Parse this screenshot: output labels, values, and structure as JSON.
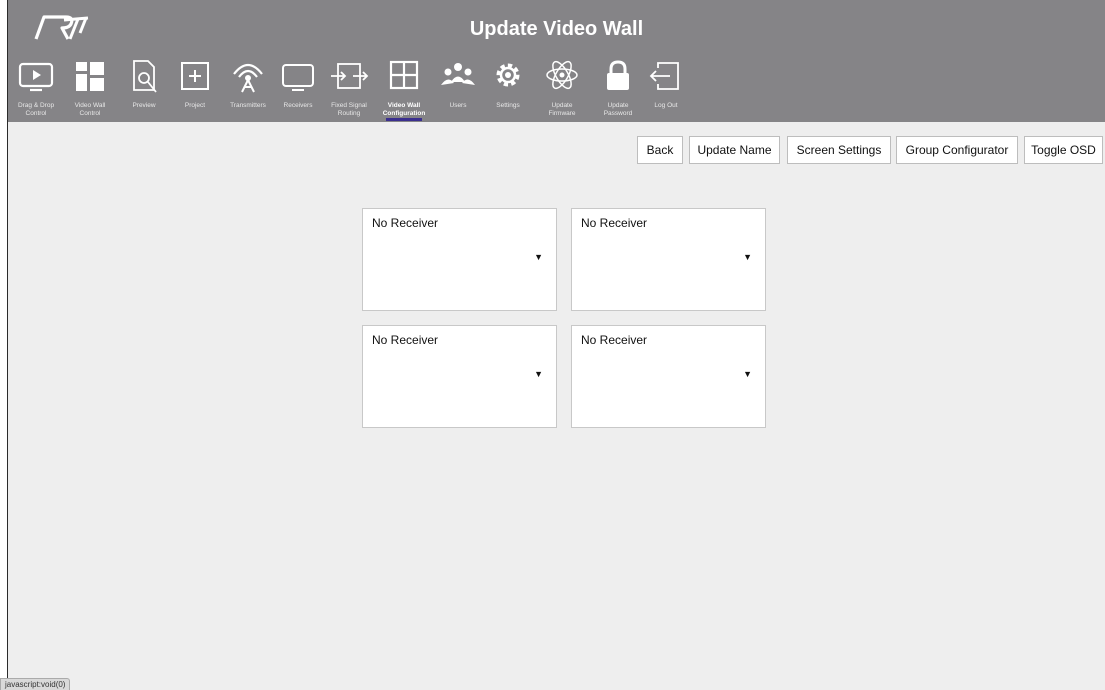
{
  "header": {
    "title": "Update Video Wall",
    "logo_text": "RTI"
  },
  "nav": [
    {
      "label": "Drag & Drop\nControl",
      "icon": "play-screen-icon"
    },
    {
      "label": "Video Wall\nControl",
      "icon": "video-wall-icon"
    },
    {
      "label": "Preview",
      "icon": "preview-icon"
    },
    {
      "label": "Project",
      "icon": "project-plus-icon"
    },
    {
      "label": "Transmitters",
      "icon": "antenna-icon"
    },
    {
      "label": "Receivers",
      "icon": "monitor-icon"
    },
    {
      "label": "Fixed Signal\nRouting",
      "icon": "routing-icon"
    },
    {
      "label": "Video Wall\nConfiguration",
      "icon": "grid-icon",
      "active": true
    },
    {
      "label": "Users",
      "icon": "users-icon"
    },
    {
      "label": "Settings",
      "icon": "gear-icon"
    },
    {
      "label": "Update\nFirmware",
      "icon": "atom-icon"
    },
    {
      "label": "Update\nPassword",
      "icon": "lock-icon"
    },
    {
      "label": "Log Out",
      "icon": "logout-icon"
    }
  ],
  "toolbar": {
    "back": "Back",
    "update_name": "Update Name",
    "screen_settings": "Screen Settings",
    "group_configurator": "Group Configurator",
    "toggle_osd": "Toggle OSD"
  },
  "wall": {
    "cells": [
      {
        "receiver": "No Receiver"
      },
      {
        "receiver": "No Receiver"
      },
      {
        "receiver": "No Receiver"
      },
      {
        "receiver": "No Receiver"
      }
    ],
    "dropdown_arrow": "▼"
  },
  "status_bar": "javascript:void(0)"
}
